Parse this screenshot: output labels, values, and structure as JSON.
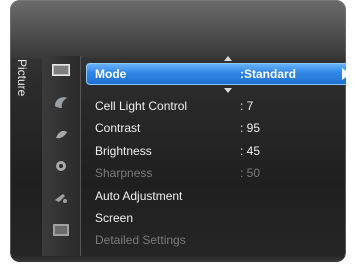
{
  "menu": {
    "section_title": "Picture",
    "icons": [
      "picture-icon",
      "sound-icon",
      "channel-icon",
      "setup-icon",
      "input-icon",
      "application-icon"
    ],
    "rows": [
      {
        "label": "Mode",
        "value": ":Standard",
        "selected": true,
        "enabled": true
      },
      {
        "label": "Cell Light Control",
        "value": ": 7",
        "selected": false,
        "enabled": true
      },
      {
        "label": "Contrast",
        "value": ": 95",
        "selected": false,
        "enabled": true
      },
      {
        "label": "Brightness",
        "value": ": 45",
        "selected": false,
        "enabled": true
      },
      {
        "label": "Sharpness",
        "value": ": 50",
        "selected": false,
        "enabled": false
      },
      {
        "label": "Auto Adjustment",
        "value": "",
        "selected": false,
        "enabled": true
      },
      {
        "label": "Screen",
        "value": "",
        "selected": false,
        "enabled": true
      },
      {
        "label": "Detailed Settings",
        "value": "",
        "selected": false,
        "enabled": false
      }
    ]
  },
  "colors": {
    "highlight": "#2f86e6",
    "dim_text": "#7b7b7b",
    "text": "#f0f0f0"
  }
}
